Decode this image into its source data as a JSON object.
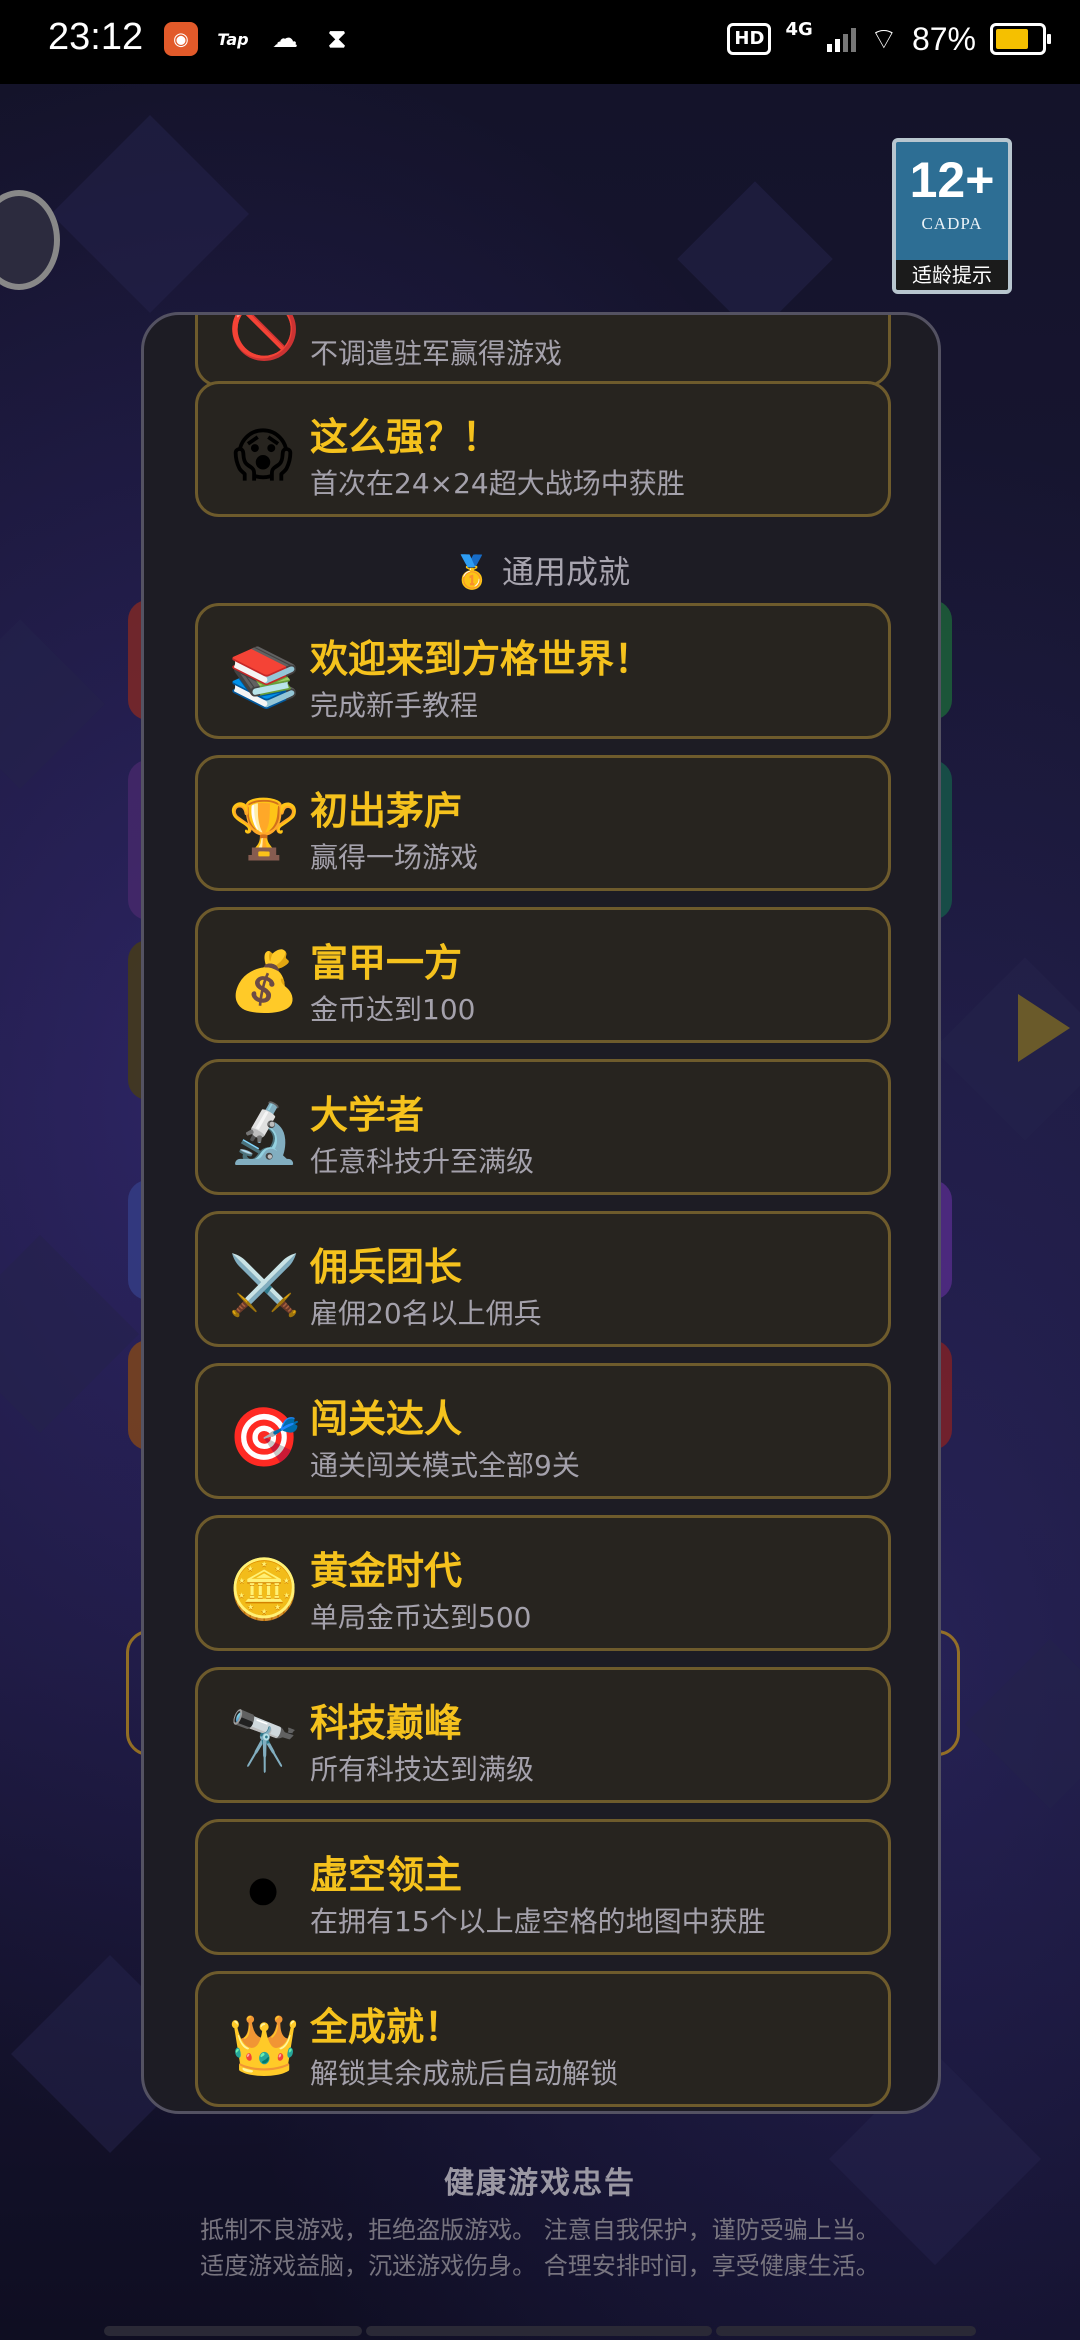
{
  "status_bar": {
    "time": "23:12",
    "notif_tap": "Tap",
    "signal_label": "4G",
    "hd_label": "HD",
    "battery_text": "87%",
    "battery_level": 0.87
  },
  "age_rating": {
    "age": "12+",
    "org": "CADPA",
    "hint": "适龄提示"
  },
  "achievements_top": [
    {
      "icon": "no-entry-icon",
      "emoji": "🚫",
      "title": "",
      "desc": "不调遣驻军赢得游戏"
    },
    {
      "icon": "scream-face-icon",
      "emoji": "😱",
      "title": "这么强？！",
      "desc": "首次在24×24超大战场中获胜"
    }
  ],
  "section": {
    "icon": "medal-icon",
    "emoji": "🥇",
    "label": "通用成就"
  },
  "achievements": [
    {
      "icon": "books-icon",
      "emoji": "📚",
      "title": "欢迎来到方格世界！",
      "desc": "完成新手教程"
    },
    {
      "icon": "trophy-icon",
      "emoji": "🏆",
      "title": "初出茅庐",
      "desc": "赢得一场游戏"
    },
    {
      "icon": "money-bag-icon",
      "emoji": "💰",
      "title": "富甲一方",
      "desc": "金币达到100"
    },
    {
      "icon": "microscope-icon",
      "emoji": "🔬",
      "title": "大学者",
      "desc": "任意科技升至满级"
    },
    {
      "icon": "crossed-swords-icon",
      "emoji": "⚔️",
      "title": "佣兵团长",
      "desc": "雇佣20名以上佣兵"
    },
    {
      "icon": "target-icon",
      "emoji": "🎯",
      "title": "闯关达人",
      "desc": "通关闯关模式全部9关"
    },
    {
      "icon": "gold-coin-icon",
      "emoji": "🪙",
      "title": "黄金时代",
      "desc": "单局金币达到500"
    },
    {
      "icon": "telescope-icon",
      "emoji": "🔭",
      "title": "科技巅峰",
      "desc": "所有科技达到满级"
    },
    {
      "icon": "void-orb-icon",
      "emoji": "⚫",
      "title": "虚空领主",
      "desc": "在拥有15个以上虚空格的地图中获胜"
    },
    {
      "icon": "crown-icon",
      "emoji": "👑",
      "title": "全成就！",
      "desc": "解锁其余成就后自动解锁"
    }
  ],
  "footer": {
    "title": "健康游戏忠告",
    "line1": "抵制不良游戏，拒绝盗版游戏。  注意自我保护，谨防受骗上当。",
    "line2": "适度游戏益脑，沉迷游戏伤身。  合理安排时间，享受健康生活。"
  },
  "colors": {
    "gold_title": "#f5c21d",
    "item_border": "#6e5b2c",
    "panel_bg": "#1d1c24"
  }
}
